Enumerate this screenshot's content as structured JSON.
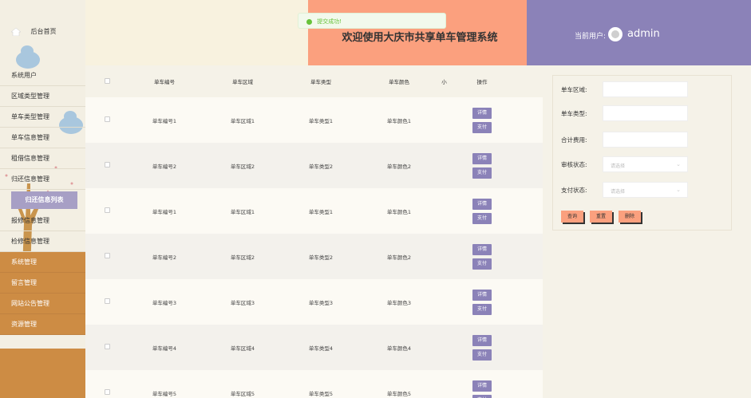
{
  "sidebar": {
    "home_label": "后台首页",
    "items": [
      {
        "label": "系统用户"
      },
      {
        "label": "区域类型管理"
      },
      {
        "label": "单车类型管理"
      },
      {
        "label": "单车信息管理"
      },
      {
        "label": "租借信息管理"
      },
      {
        "label": "归还信息管理"
      },
      {
        "label": "归还信息列表"
      },
      {
        "label": "报修信息管理"
      },
      {
        "label": "检修信息管理"
      },
      {
        "label": "系统管理"
      },
      {
        "label": "留言管理"
      },
      {
        "label": "网站公告管理"
      },
      {
        "label": "资源管理"
      }
    ]
  },
  "header": {
    "title": "欢迎使用大庆市共享单车管理系统",
    "user_label": "当前用户:",
    "username": "admin",
    "toast": "提交成功!"
  },
  "table": {
    "columns": [
      "单车编号",
      "单车区域",
      "单车类型",
      "单车颜色",
      "小",
      "操作"
    ],
    "detail_label": "详情",
    "pay_label": "支付",
    "rows": [
      {
        "no": "单车编号1",
        "area": "单车区域1",
        "type": "单车类型1",
        "color": "单车颜色1"
      },
      {
        "no": "单车编号2",
        "area": "单车区域2",
        "type": "单车类型2",
        "color": "单车颜色2"
      },
      {
        "no": "单车编号1",
        "area": "单车区域1",
        "type": "单车类型1",
        "color": "单车颜色1"
      },
      {
        "no": "单车编号2",
        "area": "单车区域2",
        "type": "单车类型2",
        "color": "单车颜色2"
      },
      {
        "no": "单车编号3",
        "area": "单车区域3",
        "type": "单车类型3",
        "color": "单车颜色3"
      },
      {
        "no": "单车编号4",
        "area": "单车区域4",
        "type": "单车类型4",
        "color": "单车颜色4"
      },
      {
        "no": "单车编号5",
        "area": "单车区域5",
        "type": "单车类型5",
        "color": "单车颜色5"
      }
    ]
  },
  "filter": {
    "area_label": "单车区域:",
    "type_label": "单车类型:",
    "cost_label": "合计费用:",
    "audit_label": "审核状态:",
    "pay_label": "支付状态:",
    "select_placeholder": "请选择",
    "search_btn": "查询",
    "reset_btn": "重置",
    "delete_btn": "删除"
  },
  "colors": {
    "accent_purple": "#8b82b8",
    "accent_orange": "#fba07e",
    "sidebar_orange": "#cd8c44",
    "toast_green": "#67c23a"
  }
}
